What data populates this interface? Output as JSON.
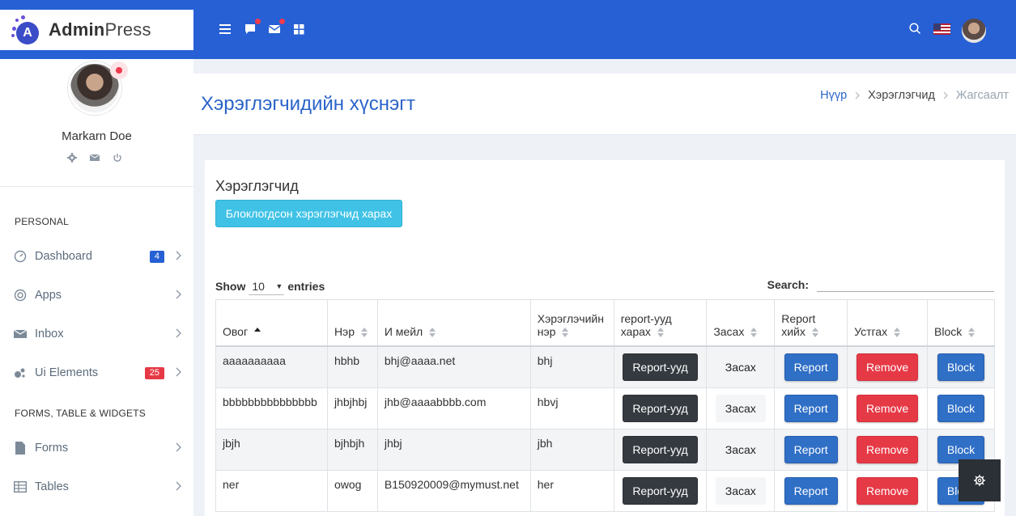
{
  "brand": {
    "name_bold": "Admin",
    "name_rest": "Press",
    "mark_letter": "A"
  },
  "topbar": {
    "icons": [
      "menu-icon",
      "chat-icon",
      "mail-icon",
      "grid-icon",
      "search-icon"
    ]
  },
  "profile": {
    "name": "Markarn Doe"
  },
  "sidebar": {
    "section_personal": "PERSONAL",
    "section_forms": "FORMS, TABLE & WIDGETS",
    "items": [
      {
        "label": "Dashboard",
        "icon": "gauge-icon",
        "badge": "4",
        "badge_color": "#2660d4"
      },
      {
        "label": "Apps",
        "icon": "target-icon"
      },
      {
        "label": "Inbox",
        "icon": "mail-icon"
      },
      {
        "label": "Ui Elements",
        "icon": "bubbles-icon",
        "badge": "25",
        "badge_color": "#e63946"
      },
      {
        "label": "Forms",
        "icon": "file-icon"
      },
      {
        "label": "Tables",
        "icon": "table-icon"
      }
    ]
  },
  "page": {
    "title": "Хэрэглэгчидийн хүснэгт",
    "breadcrumb": {
      "home": "Нүүр",
      "mid": "Хэрэглэгчид",
      "active": "Жагсаалт"
    }
  },
  "card": {
    "title": "Хэрэглэгчид",
    "blocked_button": "Блоклогдсон хэрэглэгчид харах",
    "show_label": "Show",
    "entries_value": "10",
    "entries_label": "entries",
    "search_label": "Search:"
  },
  "table": {
    "headers": [
      "Овог",
      "Нэр",
      "И мейл",
      "Хэрэглэчийн нэр",
      "report-ууд харах",
      "Засах",
      "Report хийх",
      "Устгах",
      "Block"
    ],
    "rows": [
      {
        "lastname": "aaaaaaaaaa",
        "name": "hbhb",
        "email": "bhj@aaaa.net",
        "username": "bhj"
      },
      {
        "lastname": "bbbbbbbbbbbbbbb",
        "name": "jhbjhbj",
        "email": "jhb@aaaabbbb.com",
        "username": "hbvj"
      },
      {
        "lastname": "jbjh",
        "name": "bjhbjh",
        "email": "jhbj",
        "username": "jbh"
      },
      {
        "lastname": "ner",
        "name": "owog",
        "email": "B150920009@mymust.net",
        "username": "her"
      }
    ],
    "buttons": {
      "reports": "Report-ууд",
      "edit": "Засах",
      "report": "Report",
      "remove": "Remove",
      "block": "Block"
    }
  }
}
